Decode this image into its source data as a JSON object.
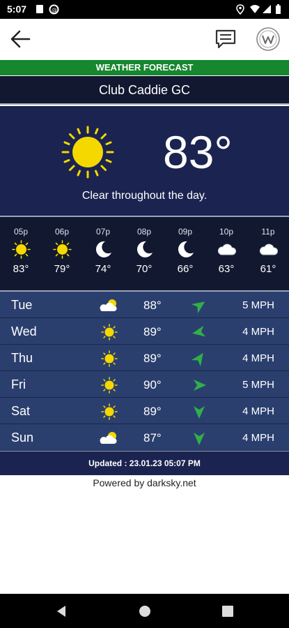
{
  "status_bar": {
    "time": "5:07"
  },
  "banner": {
    "label": "WEATHER FORECAST"
  },
  "course": {
    "name": "Club Caddie GC"
  },
  "current": {
    "temperature": "83°",
    "summary": "Clear throughout the day.",
    "icon": "sun-icon"
  },
  "hourly": [
    {
      "time": "05p",
      "temp": "83°",
      "icon": "sun-icon"
    },
    {
      "time": "06p",
      "temp": "79°",
      "icon": "sun-icon"
    },
    {
      "time": "07p",
      "temp": "74°",
      "icon": "moon-icon"
    },
    {
      "time": "08p",
      "temp": "70°",
      "icon": "moon-icon"
    },
    {
      "time": "09p",
      "temp": "66°",
      "icon": "moon-icon"
    },
    {
      "time": "10p",
      "temp": "63°",
      "icon": "cloud-icon"
    },
    {
      "time": "11p",
      "temp": "61°",
      "icon": "cloud-icon"
    }
  ],
  "daily": [
    {
      "day": "Tue",
      "temp": "88°",
      "wind": "5 MPH",
      "icon": "partly-cloudy-icon"
    },
    {
      "day": "Wed",
      "temp": "89°",
      "wind": "4 MPH",
      "icon": "sun-icon"
    },
    {
      "day": "Thu",
      "temp": "89°",
      "wind": "4 MPH",
      "icon": "sun-icon"
    },
    {
      "day": "Fri",
      "temp": "90°",
      "wind": "5 MPH",
      "icon": "sun-icon"
    },
    {
      "day": "Sat",
      "temp": "89°",
      "wind": "4 MPH",
      "icon": "sun-icon"
    },
    {
      "day": "Sun",
      "temp": "87°",
      "wind": "4 MPH",
      "icon": "partly-cloudy-icon"
    }
  ],
  "updated": "Updated : 23.01.23 05:07 PM",
  "powered_by": "Powered by darksky.net",
  "colors": {
    "banner_green": "#16862f",
    "navy": "#1b2450",
    "row_blue": "#2b3f6e",
    "sun_yellow": "#f5d800",
    "wind_green": "#2fb04a"
  }
}
